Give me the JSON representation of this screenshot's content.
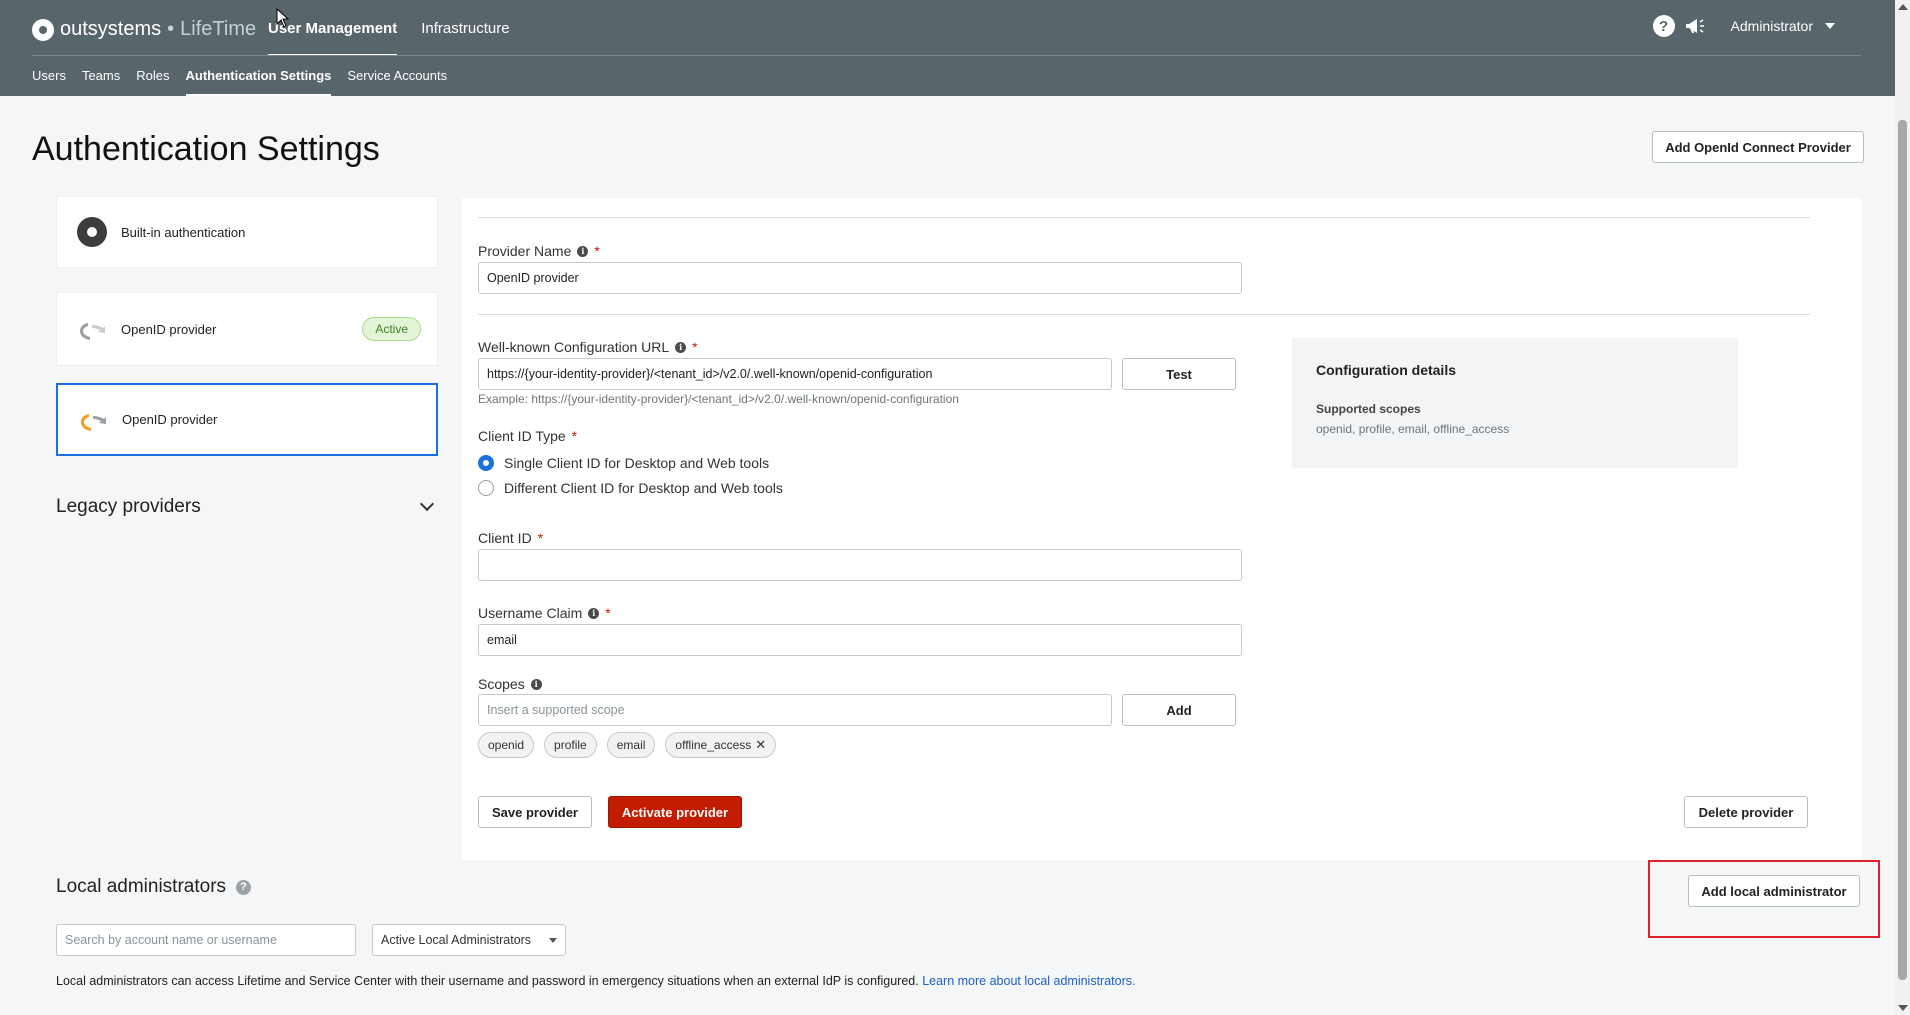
{
  "brand": {
    "name": "outsystems",
    "separator": "•",
    "product": "LifeTime"
  },
  "topnav": [
    {
      "label": "User Management",
      "active": true
    },
    {
      "label": "Infrastructure",
      "active": false
    }
  ],
  "subnav": [
    {
      "label": "Users",
      "active": false
    },
    {
      "label": "Teams",
      "active": false
    },
    {
      "label": "Roles",
      "active": false
    },
    {
      "label": "Authentication Settings",
      "active": true
    },
    {
      "label": "Service Accounts",
      "active": false
    }
  ],
  "header": {
    "help_glyph": "?",
    "user": "Administrator"
  },
  "page": {
    "title": "Authentication Settings",
    "add_oidc_button": "Add OpenId Connect Provider"
  },
  "providers": {
    "builtin": "Built-in authentication",
    "items": [
      {
        "label": "OpenID provider",
        "badge": "Active",
        "selected": false
      },
      {
        "label": "OpenID provider",
        "badge": "",
        "selected": true
      }
    ],
    "legacy_label": "Legacy providers"
  },
  "form": {
    "provider_name_label": "Provider Name",
    "provider_name_value": "OpenID provider",
    "wellknown_label": "Well-known Configuration URL",
    "wellknown_value": "https://{your-identity-provider}/<tenant_id>/v2.0/.well-known/openid-configuration",
    "wellknown_example": "Example: https://{your-identity-provider}/<tenant_id>/v2.0/.well-known/openid-configuration",
    "test_button": "Test",
    "client_id_type_label": "Client ID Type",
    "client_id_type_options": [
      {
        "label": "Single Client ID for Desktop and Web tools",
        "checked": true
      },
      {
        "label": "Different Client ID for Desktop and Web tools",
        "checked": false
      }
    ],
    "client_id_label": "Client ID",
    "client_id_value": "",
    "username_claim_label": "Username Claim",
    "username_claim_value": "email",
    "scopes_label": "Scopes",
    "scopes_placeholder": "Insert a supported scope",
    "add_button": "Add",
    "scopes": [
      "openid",
      "profile",
      "email",
      "offline_access"
    ],
    "close_glyph": "✕",
    "required_mark": "*",
    "info_glyph": "i",
    "save_button": "Save provider",
    "activate_button": "Activate provider",
    "delete_button": "Delete provider"
  },
  "config_details": {
    "title": "Configuration details",
    "supported_scopes_label": "Supported scopes",
    "supported_scopes_value": "openid, profile, email, offline_access"
  },
  "local_admins": {
    "title": "Local administrators",
    "help_glyph": "?",
    "add_button": "Add local administrator",
    "search_placeholder": "Search by account name or username",
    "filter_value": "Active Local Administrators",
    "note": "Local administrators can access Lifetime and Service Center with their username and password in emergency situations when an external IdP is configured. ",
    "learn_more": "Learn more about local administrators."
  },
  "colors": {
    "header": "#58656b",
    "primary": "#c21d00",
    "accent": "#1c6fe0",
    "highlight": "#e0202a"
  }
}
